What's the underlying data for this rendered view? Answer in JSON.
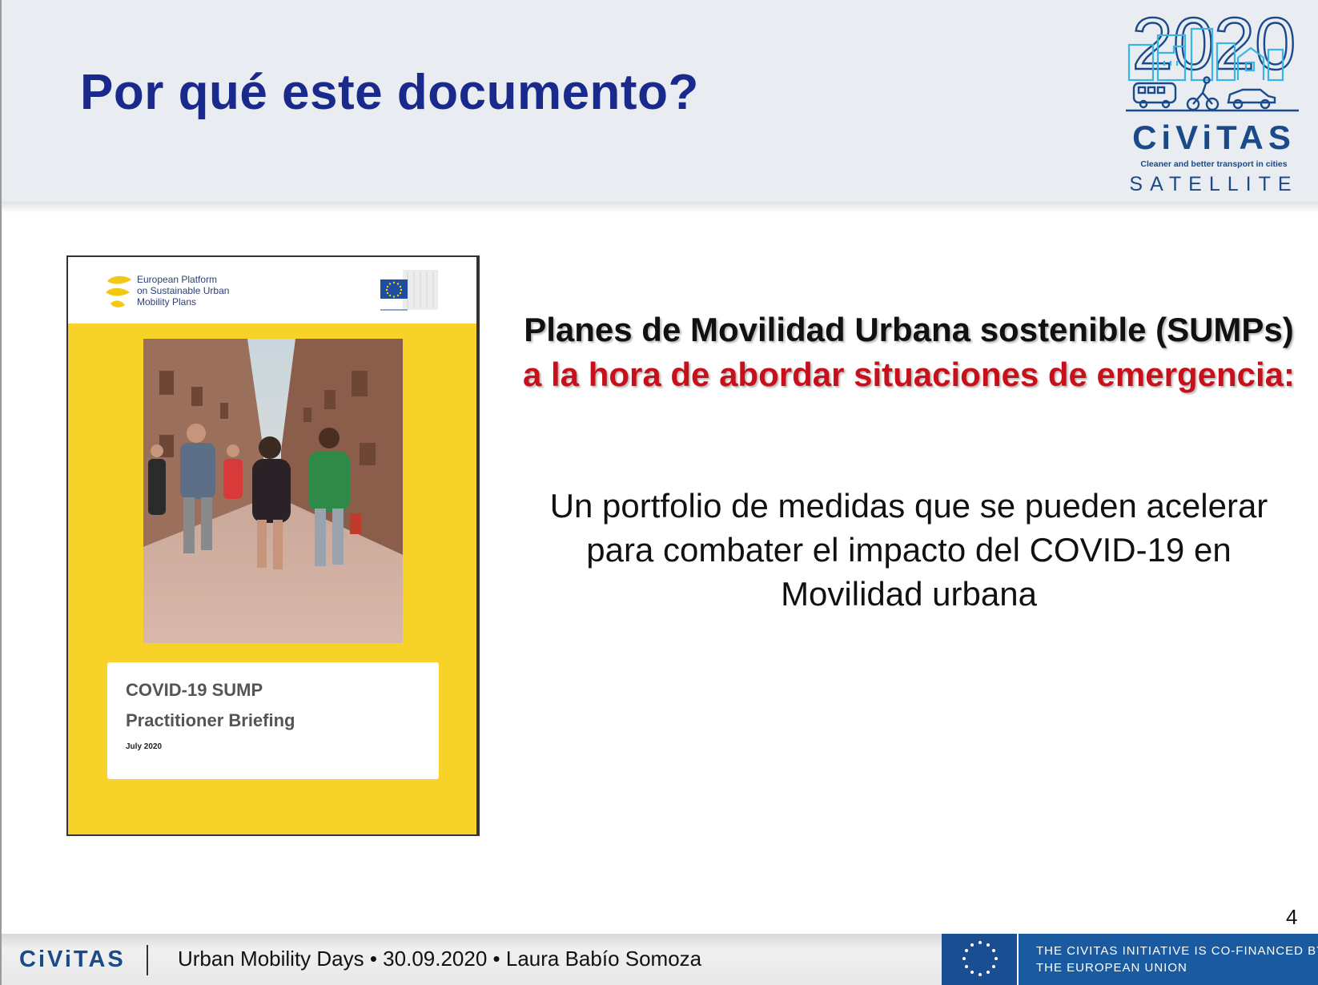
{
  "slide": {
    "title": "Por qué este documento?",
    "page_number": "4"
  },
  "logo": {
    "year": "2020",
    "brand": "CiViTAS",
    "tagline": "Cleaner and better transport in cities",
    "satellite": "SATELLITE"
  },
  "cover": {
    "platform_lines": [
      "European Platform",
      "on Sustainable Urban",
      "Mobility Plans"
    ],
    "ec_label": "European Commission",
    "title": "COVID-19 SUMP",
    "subtitle": "Practitioner Briefing",
    "date": "July 2020"
  },
  "content": {
    "heading_black": "Planes de Movilidad Urbana sostenible (SUMPs)",
    "heading_red": "a la hora de abordar situaciones de emergencia:",
    "body": "Un portfolio de medidas que se pueden acelerar para combater el impacto del COVID-19 en Movilidad urbana"
  },
  "footer": {
    "brand": "CiViTAS",
    "event_text": "Urban Mobility Days • 30.09.2020 • Laura Babío Somoza",
    "eu_lines": [
      "THE CIVITAS INITIATIVE IS CO-FINANCED BY",
      "THE EUROPEAN UNION"
    ]
  },
  "colors": {
    "title_blue": "#1a2a8c",
    "civitas_blue": "#1a4a8a",
    "highlight_red": "#c8101a",
    "cover_yellow": "#f7d228",
    "header_bg": "#e9ecf0"
  }
}
